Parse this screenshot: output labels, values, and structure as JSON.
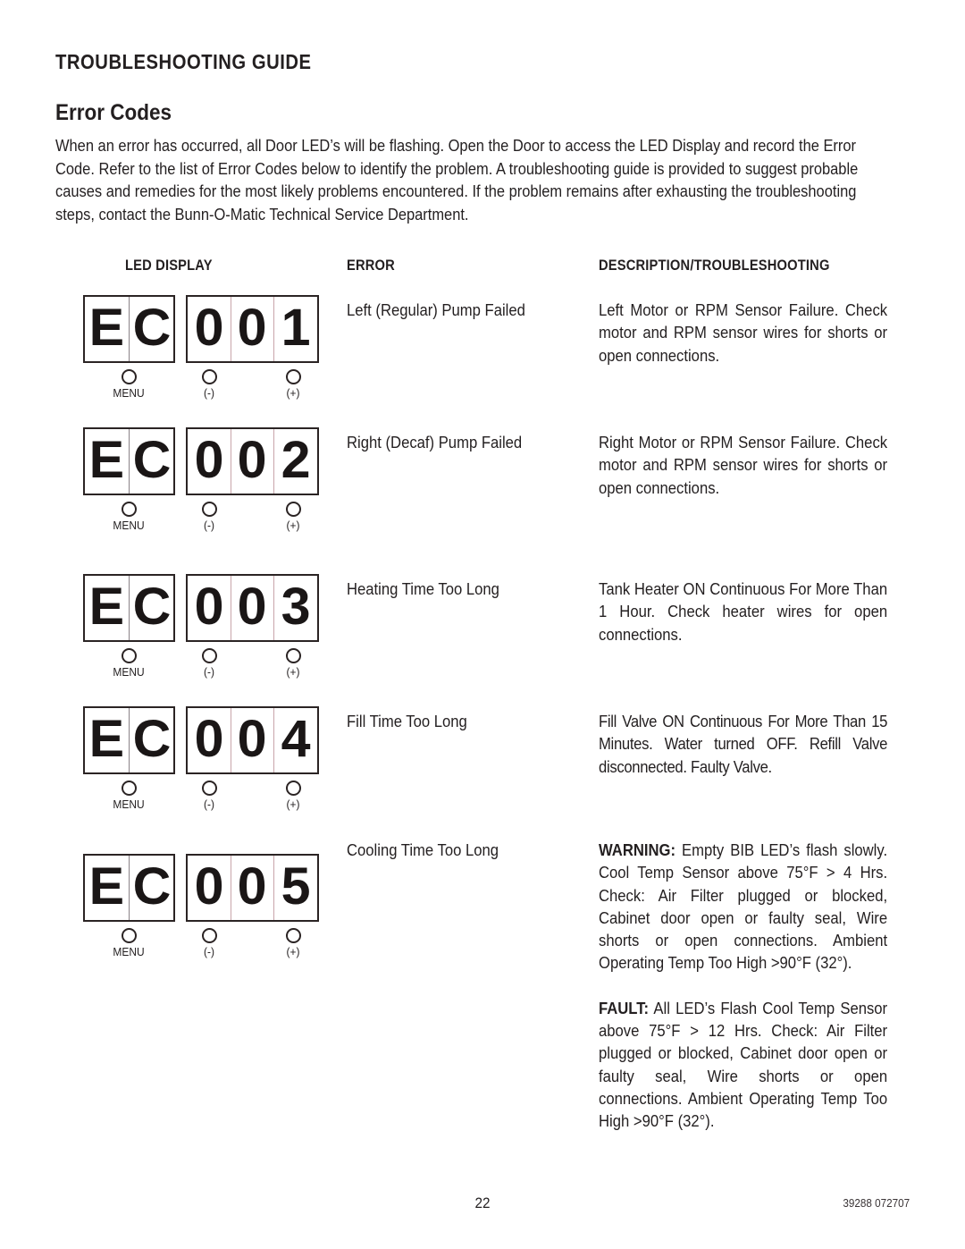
{
  "document": {
    "guide_title": "TROUBLESHOOTING GUIDE",
    "section_title": "Error Codes",
    "intro": "When an error has occurred, all Door LED’s will be flashing. Open the Door to access the LED Display and record the Error Code. Refer to the list of Error Codes below to identify the problem. A troubleshooting guide is provided to suggest probable causes and remedies for the most likely problems encountered.  If the problem remains after exhausting the troubleshooting steps, contact the Bunn-O-Matic Technical Service Department.",
    "page_number": "22",
    "doc_code": "39288 072707"
  },
  "table": {
    "headers": {
      "led_display": "LED DISPLAY",
      "error": "ERROR",
      "description": "DESCRIPTION/TROUBLESHOOTING"
    },
    "button_labels": [
      "MENU",
      "(-)",
      "(+)"
    ],
    "rows": [
      {
        "prefix": "EC",
        "code": "001",
        "prefix_chars": [
          "E",
          "C"
        ],
        "code_chars": [
          "0",
          "0",
          "1"
        ],
        "error": "Left (Regular) Pump Failed",
        "description": "Left Motor or RPM Sensor Failure. Check motor and RPM sensor wires for shorts or open connections."
      },
      {
        "prefix": "EC",
        "code": "002",
        "prefix_chars": [
          "E",
          "C"
        ],
        "code_chars": [
          "0",
          "0",
          "2"
        ],
        "error": "Right (Decaf) Pump Failed",
        "description": "Right Motor or RPM Sensor Failure. Check motor and RPM sensor wires for shorts or open connections."
      },
      {
        "prefix": "EC",
        "code": "003",
        "prefix_chars": [
          "E",
          "C"
        ],
        "code_chars": [
          "0",
          "0",
          "3"
        ],
        "error": "Heating Time Too Long",
        "description": "Tank Heater ON Continuous For More Than 1 Hour. Check heater wires for open connections."
      },
      {
        "prefix": "EC",
        "code": "004",
        "prefix_chars": [
          "E",
          "C"
        ],
        "code_chars": [
          "0",
          "0",
          "4"
        ],
        "error": "Fill Time Too Long",
        "description": "Fill Valve ON Continuous For More Than 15 Minutes. Water turned OFF. Refill Valve disconnected. Faulty Valve."
      },
      {
        "prefix": "EC",
        "code": "005",
        "prefix_chars": [
          "E",
          "C"
        ],
        "code_chars": [
          "0",
          "0",
          "5"
        ],
        "error": "Cooling Time Too Long",
        "description_warning_label": "WARNING:",
        "description_warning": " Empty BIB LED’s flash slowly. Cool Temp Sensor above 75°F > 4 Hrs. Check: Air Filter plugged or blocked, Cabinet door open or faulty seal, Wire shorts or open connections. Ambient Operating Temp Too High >90°F (32°).",
        "description_fault_label": "FAULT:",
        "description_fault": " All LED’s Flash Cool Temp Sensor above 75°F > 12 Hrs. Check: Air Filter plugged or blocked, Cabinet door open or faulty seal, Wire shorts or open connections. Ambient Operating Temp Too High >90°F (32°)."
      }
    ]
  }
}
